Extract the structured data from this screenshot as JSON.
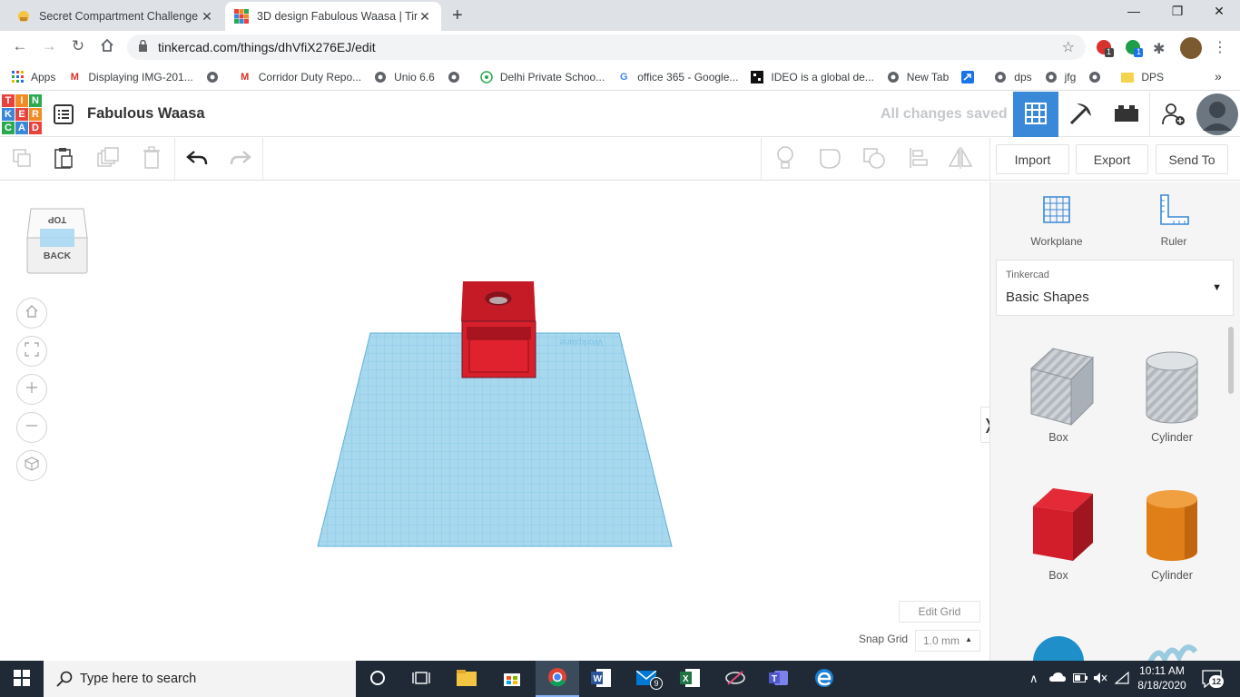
{
  "browser": {
    "tabs": [
      {
        "title": "Secret Compartment Challenge -",
        "active": false
      },
      {
        "title": "3D design Fabulous Waasa | Tink",
        "active": true
      }
    ],
    "new_tab": "+",
    "window_controls": {
      "minimize": "—",
      "maximize": "❐",
      "close": "✕"
    },
    "url": "tinkercad.com/things/dhVfiX276EJ/edit",
    "bookmarks": [
      {
        "label": "Apps",
        "icon": "apps-grid-icon"
      },
      {
        "label": "Displaying IMG-201...",
        "icon": "gmail-icon"
      },
      {
        "label": "",
        "icon": "globe-icon"
      },
      {
        "label": "Corridor Duty Repo...",
        "icon": "gmail-icon"
      },
      {
        "label": "Unio 6.6",
        "icon": "globe-icon"
      },
      {
        "label": "",
        "icon": "globe-icon"
      },
      {
        "label": "Delhi Private Schoo...",
        "icon": "school-icon"
      },
      {
        "label": "office 365 - Google...",
        "icon": "google-icon"
      },
      {
        "label": "IDEO is a global de...",
        "icon": "ideo-icon"
      },
      {
        "label": "New Tab",
        "icon": "globe-icon"
      },
      {
        "label": "",
        "icon": "arrow-box-icon"
      },
      {
        "label": "dps",
        "icon": "globe-icon"
      },
      {
        "label": "jfg",
        "icon": "globe-icon"
      },
      {
        "label": "",
        "icon": "globe-icon"
      },
      {
        "label": "DPS",
        "icon": "folder-icon"
      }
    ],
    "bookmarks_more": "»",
    "extension_badges": {
      "first": "1",
      "second": "1"
    }
  },
  "tinkercad": {
    "logo_letters": [
      "T",
      "I",
      "N",
      "K",
      "E",
      "R",
      "C",
      "A",
      "D"
    ],
    "design_title": "Fabulous Waasa",
    "save_status": "All changes saved",
    "toolbar": {
      "import_label": "Import",
      "export_label": "Export",
      "send_to_label": "Send To"
    },
    "view_cube": {
      "top": "TOP",
      "front": "BACK"
    },
    "grid": {
      "edit_grid_label": "Edit Grid",
      "snap_grid_label": "Snap Grid",
      "snap_grid_value": "1.0 mm"
    },
    "workplane_watermark": "Workplane",
    "right_panel": {
      "workplane_label": "Workplane",
      "ruler_label": "Ruler",
      "library_source": "Tinkercad",
      "library_name": "Basic Shapes",
      "shapes": [
        {
          "label": "Box",
          "style": "hole"
        },
        {
          "label": "Cylinder",
          "style": "hole"
        },
        {
          "label": "Box",
          "style": "solid"
        },
        {
          "label": "Cylinder",
          "style": "solid"
        }
      ]
    },
    "colors": {
      "accent": "#3a88d8",
      "box_red": "#d8202c",
      "cylinder_orange": "#e07e18",
      "grid_blue": "#a7d8ee"
    }
  },
  "taskbar": {
    "search_placeholder": "Type here to search",
    "time": "10:11 AM",
    "date": "8/18/2020",
    "notifications_count": "12",
    "mail_badge": "9"
  }
}
